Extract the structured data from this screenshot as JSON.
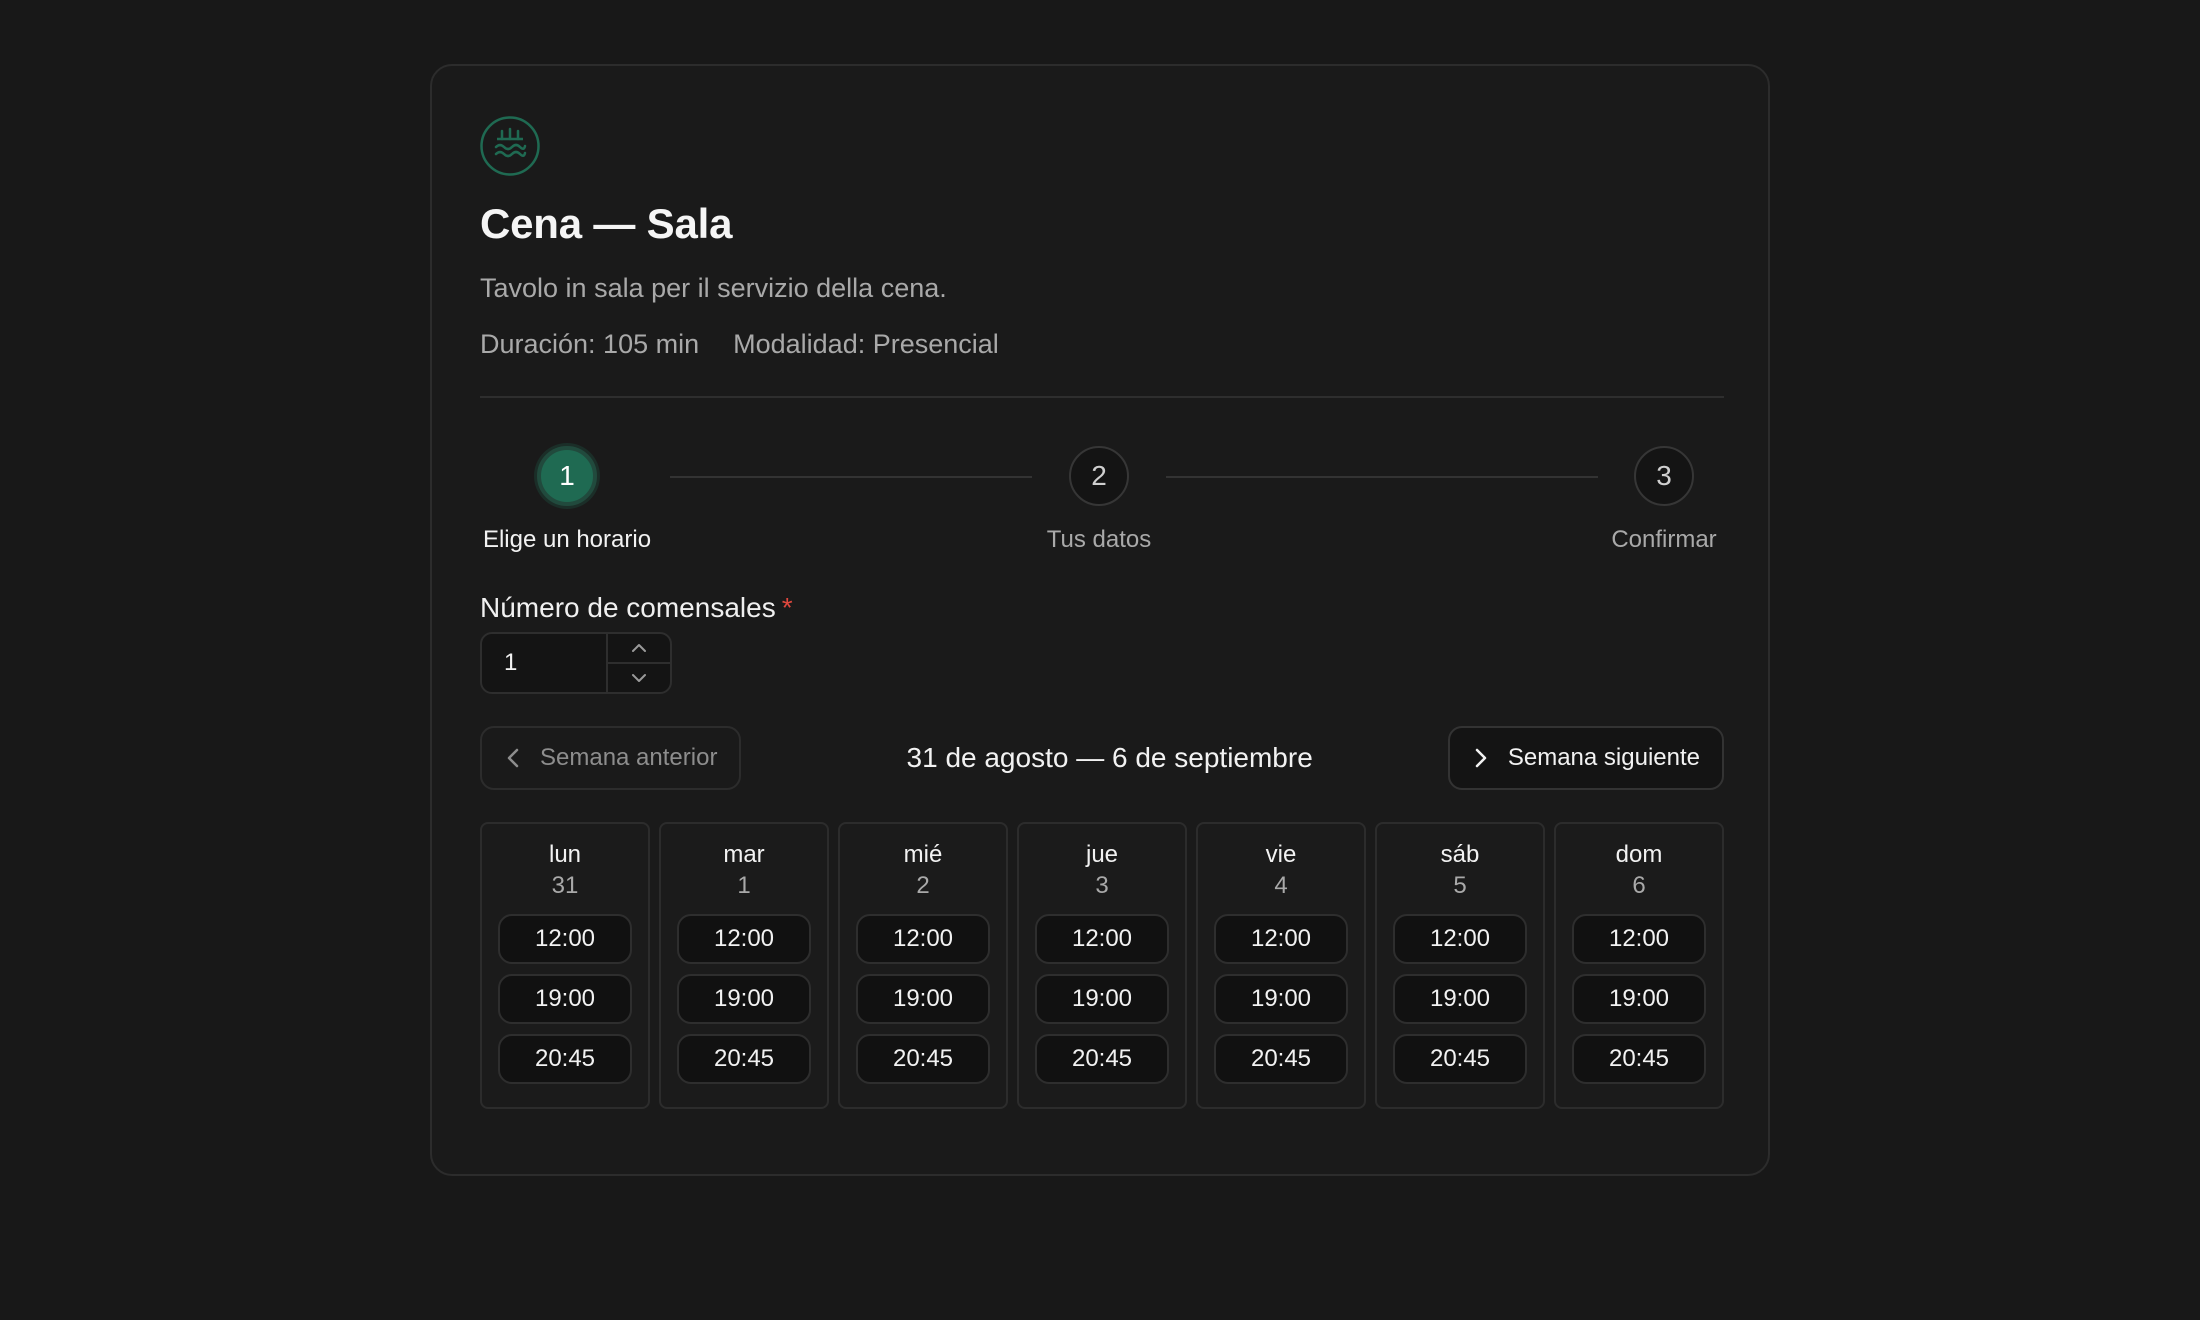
{
  "service": {
    "title": "Cena — Sala",
    "description": "Tavolo in sala per il servizio della cena.",
    "duration": "Duración: 105 min",
    "modality": "Modalidad: Presencial",
    "logo_icon": "restaurant-logo-icon",
    "accent_color": "#1f6a52"
  },
  "steps": [
    {
      "number": "1",
      "label": "Elige un horario",
      "active": true
    },
    {
      "number": "2",
      "label": "Tus datos",
      "active": false
    },
    {
      "number": "3",
      "label": "Confirmar",
      "active": false
    }
  ],
  "guests": {
    "label": "Número de comensales",
    "required_mark": "*",
    "value": "1",
    "increment_icon": "chevron-up-icon",
    "decrement_icon": "chevron-down-icon"
  },
  "week_nav": {
    "prev_label": "Semana anterior",
    "next_label": "Semana siguiente",
    "range": "31 de agosto — 6 de septiembre",
    "prev_icon": "chevron-left-icon",
    "next_icon": "chevron-right-icon"
  },
  "days": [
    {
      "name": "lun",
      "num": "31",
      "slots": [
        "12:00",
        "19:00",
        "20:45"
      ]
    },
    {
      "name": "mar",
      "num": "1",
      "slots": [
        "12:00",
        "19:00",
        "20:45"
      ]
    },
    {
      "name": "mié",
      "num": "2",
      "slots": [
        "12:00",
        "19:00",
        "20:45"
      ]
    },
    {
      "name": "jue",
      "num": "3",
      "slots": [
        "12:00",
        "19:00",
        "20:45"
      ]
    },
    {
      "name": "vie",
      "num": "4",
      "slots": [
        "12:00",
        "19:00",
        "20:45"
      ]
    },
    {
      "name": "sáb",
      "num": "5",
      "slots": [
        "12:00",
        "19:00",
        "20:45"
      ]
    },
    {
      "name": "dom",
      "num": "6",
      "slots": [
        "12:00",
        "19:00",
        "20:45"
      ]
    }
  ]
}
